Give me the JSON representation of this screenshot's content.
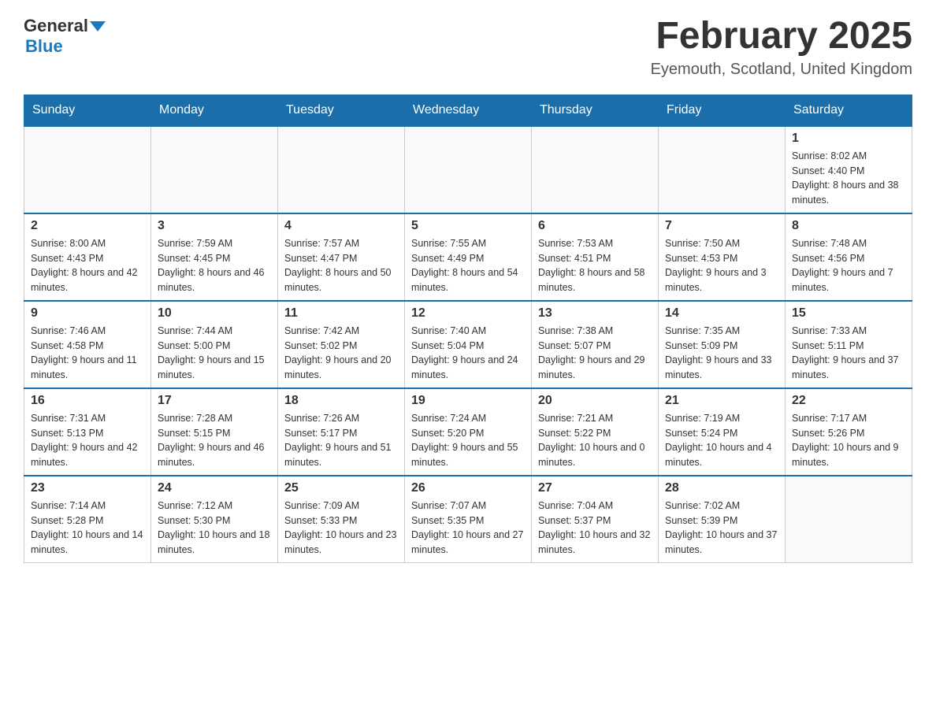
{
  "header": {
    "logo_general": "General",
    "logo_blue": "Blue",
    "month_title": "February 2025",
    "location": "Eyemouth, Scotland, United Kingdom"
  },
  "days_of_week": [
    "Sunday",
    "Monday",
    "Tuesday",
    "Wednesday",
    "Thursday",
    "Friday",
    "Saturday"
  ],
  "weeks": [
    [
      {
        "day": "",
        "info": ""
      },
      {
        "day": "",
        "info": ""
      },
      {
        "day": "",
        "info": ""
      },
      {
        "day": "",
        "info": ""
      },
      {
        "day": "",
        "info": ""
      },
      {
        "day": "",
        "info": ""
      },
      {
        "day": "1",
        "info": "Sunrise: 8:02 AM\nSunset: 4:40 PM\nDaylight: 8 hours and 38 minutes."
      }
    ],
    [
      {
        "day": "2",
        "info": "Sunrise: 8:00 AM\nSunset: 4:43 PM\nDaylight: 8 hours and 42 minutes."
      },
      {
        "day": "3",
        "info": "Sunrise: 7:59 AM\nSunset: 4:45 PM\nDaylight: 8 hours and 46 minutes."
      },
      {
        "day": "4",
        "info": "Sunrise: 7:57 AM\nSunset: 4:47 PM\nDaylight: 8 hours and 50 minutes."
      },
      {
        "day": "5",
        "info": "Sunrise: 7:55 AM\nSunset: 4:49 PM\nDaylight: 8 hours and 54 minutes."
      },
      {
        "day": "6",
        "info": "Sunrise: 7:53 AM\nSunset: 4:51 PM\nDaylight: 8 hours and 58 minutes."
      },
      {
        "day": "7",
        "info": "Sunrise: 7:50 AM\nSunset: 4:53 PM\nDaylight: 9 hours and 3 minutes."
      },
      {
        "day": "8",
        "info": "Sunrise: 7:48 AM\nSunset: 4:56 PM\nDaylight: 9 hours and 7 minutes."
      }
    ],
    [
      {
        "day": "9",
        "info": "Sunrise: 7:46 AM\nSunset: 4:58 PM\nDaylight: 9 hours and 11 minutes."
      },
      {
        "day": "10",
        "info": "Sunrise: 7:44 AM\nSunset: 5:00 PM\nDaylight: 9 hours and 15 minutes."
      },
      {
        "day": "11",
        "info": "Sunrise: 7:42 AM\nSunset: 5:02 PM\nDaylight: 9 hours and 20 minutes."
      },
      {
        "day": "12",
        "info": "Sunrise: 7:40 AM\nSunset: 5:04 PM\nDaylight: 9 hours and 24 minutes."
      },
      {
        "day": "13",
        "info": "Sunrise: 7:38 AM\nSunset: 5:07 PM\nDaylight: 9 hours and 29 minutes."
      },
      {
        "day": "14",
        "info": "Sunrise: 7:35 AM\nSunset: 5:09 PM\nDaylight: 9 hours and 33 minutes."
      },
      {
        "day": "15",
        "info": "Sunrise: 7:33 AM\nSunset: 5:11 PM\nDaylight: 9 hours and 37 minutes."
      }
    ],
    [
      {
        "day": "16",
        "info": "Sunrise: 7:31 AM\nSunset: 5:13 PM\nDaylight: 9 hours and 42 minutes."
      },
      {
        "day": "17",
        "info": "Sunrise: 7:28 AM\nSunset: 5:15 PM\nDaylight: 9 hours and 46 minutes."
      },
      {
        "day": "18",
        "info": "Sunrise: 7:26 AM\nSunset: 5:17 PM\nDaylight: 9 hours and 51 minutes."
      },
      {
        "day": "19",
        "info": "Sunrise: 7:24 AM\nSunset: 5:20 PM\nDaylight: 9 hours and 55 minutes."
      },
      {
        "day": "20",
        "info": "Sunrise: 7:21 AM\nSunset: 5:22 PM\nDaylight: 10 hours and 0 minutes."
      },
      {
        "day": "21",
        "info": "Sunrise: 7:19 AM\nSunset: 5:24 PM\nDaylight: 10 hours and 4 minutes."
      },
      {
        "day": "22",
        "info": "Sunrise: 7:17 AM\nSunset: 5:26 PM\nDaylight: 10 hours and 9 minutes."
      }
    ],
    [
      {
        "day": "23",
        "info": "Sunrise: 7:14 AM\nSunset: 5:28 PM\nDaylight: 10 hours and 14 minutes."
      },
      {
        "day": "24",
        "info": "Sunrise: 7:12 AM\nSunset: 5:30 PM\nDaylight: 10 hours and 18 minutes."
      },
      {
        "day": "25",
        "info": "Sunrise: 7:09 AM\nSunset: 5:33 PM\nDaylight: 10 hours and 23 minutes."
      },
      {
        "day": "26",
        "info": "Sunrise: 7:07 AM\nSunset: 5:35 PM\nDaylight: 10 hours and 27 minutes."
      },
      {
        "day": "27",
        "info": "Sunrise: 7:04 AM\nSunset: 5:37 PM\nDaylight: 10 hours and 32 minutes."
      },
      {
        "day": "28",
        "info": "Sunrise: 7:02 AM\nSunset: 5:39 PM\nDaylight: 10 hours and 37 minutes."
      },
      {
        "day": "",
        "info": ""
      }
    ]
  ]
}
